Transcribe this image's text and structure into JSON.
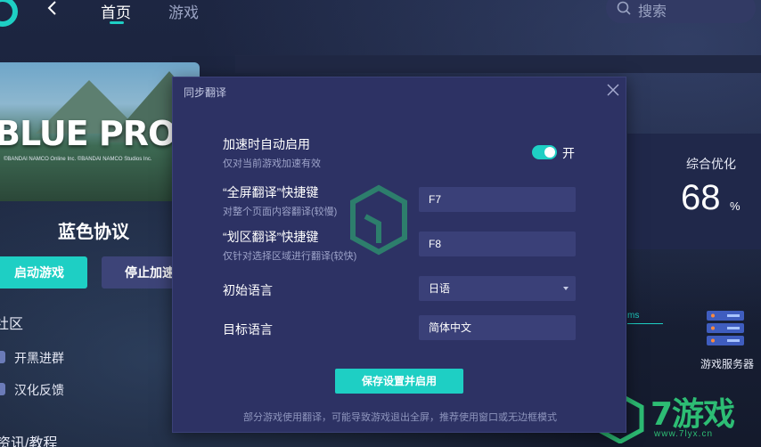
{
  "nav": {
    "home": "首页",
    "games": "游戏",
    "search_placeholder": "搜索"
  },
  "game": {
    "banner_title": "BLUE PROTOCO",
    "banner_copyright": "©BANDAI NAMCO Online Inc. ©BANDAI NAMCO Studios Inc.",
    "name": "蓝色协议",
    "start_button": "启动游戏",
    "stop_button": "停止加速"
  },
  "community": {
    "title": "社区",
    "links": [
      {
        "label": "开黑进群",
        "icon": "group-icon"
      },
      {
        "label": "汉化反馈",
        "icon": "feedback-icon"
      }
    ],
    "news_title": "资讯/教程"
  },
  "stats": {
    "optimization_label": "综合优化",
    "optimization_value": "68",
    "optimization_unit": "%",
    "ms_text": "ms",
    "server_label": "游戏服务器"
  },
  "watermark": {
    "text": "7游戏",
    "url": "www.7lyx.cn"
  },
  "dialog": {
    "title": "同步翻译",
    "auto_enable_label": "加速时自动启用",
    "auto_enable_sub": "仅对当前游戏加速有效",
    "auto_enable_state": "开",
    "fullscreen_hotkey_label": "“全屏翻译”快捷键",
    "fullscreen_hotkey_sub": "对整个页面内容翻译(较慢)",
    "fullscreen_hotkey_value": "F7",
    "region_hotkey_label": "“划区翻译”快捷键",
    "region_hotkey_sub": "仅针对选择区域进行翻译(较快)",
    "region_hotkey_value": "F8",
    "source_language_label": "初始语言",
    "source_language_value": "日语",
    "target_language_label": "目标语言",
    "target_language_value": "简体中文",
    "save_button": "保存设置并启用",
    "note": "部分游戏使用翻译，可能导致游戏退出全屏，推荐使用窗口或无边框模式"
  },
  "colors": {
    "accent": "#1ecfc4",
    "dialog_bg": "#2d3264",
    "field_bg": "#3a4078",
    "watermark_green": "#2dbd74"
  }
}
